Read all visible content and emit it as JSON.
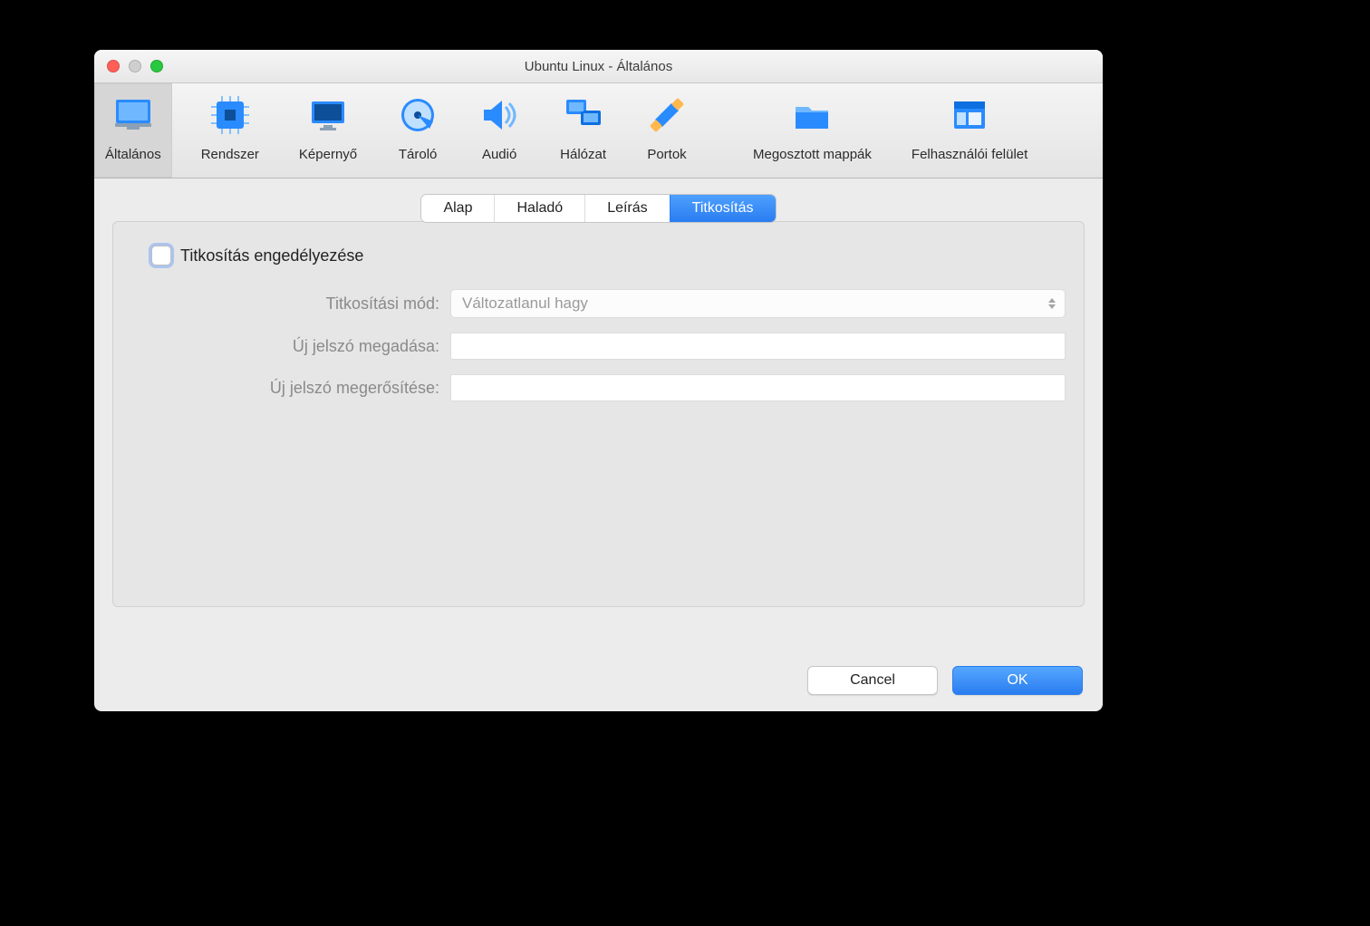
{
  "window": {
    "title": "Ubuntu Linux - Általános"
  },
  "toolbar": {
    "items": [
      {
        "label": "Általános"
      },
      {
        "label": "Rendszer"
      },
      {
        "label": "Képernyő"
      },
      {
        "label": "Tároló"
      },
      {
        "label": "Audió"
      },
      {
        "label": "Hálózat"
      },
      {
        "label": "Portok"
      },
      {
        "label": "Megosztott mappák"
      },
      {
        "label": "Felhasználói felület"
      }
    ]
  },
  "tabs": {
    "items": [
      {
        "label": "Alap"
      },
      {
        "label": "Haladó"
      },
      {
        "label": "Leírás"
      },
      {
        "label": "Titkosítás"
      }
    ]
  },
  "form": {
    "enable_label": "Titkosítás engedélyezése",
    "mode_label": "Titkosítási mód:",
    "mode_value": "Változatlanul hagy",
    "newpw_label": "Új jelszó megadása:",
    "confirm_label": "Új jelszó megerősítése:"
  },
  "footer": {
    "cancel": "Cancel",
    "ok": "OK"
  }
}
